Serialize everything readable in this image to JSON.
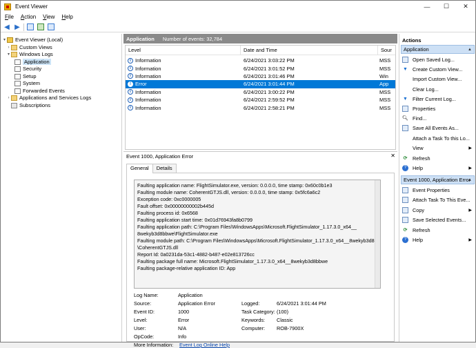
{
  "window": {
    "title": "Event Viewer",
    "controls": [
      "—",
      "☐",
      "✕"
    ]
  },
  "menu": [
    {
      "accel": "F",
      "rest": "ile"
    },
    {
      "accel": "A",
      "rest": "ction"
    },
    {
      "accel": "V",
      "rest": "iew"
    },
    {
      "accel": "H",
      "rest": "elp"
    }
  ],
  "tree": [
    {
      "label": "Event Viewer (Local)",
      "level": 0,
      "arrow": "▾",
      "icon": "event-viewer-icon"
    },
    {
      "label": "Custom Views",
      "level": 1,
      "arrow": "›",
      "icon": "folder-icon"
    },
    {
      "label": "Windows Logs",
      "level": 1,
      "arrow": "▾",
      "icon": "folder-icon"
    },
    {
      "label": "Application",
      "level": 2,
      "arrow": "",
      "icon": "log-icon",
      "selected": true
    },
    {
      "label": "Security",
      "level": 2,
      "arrow": "",
      "icon": "log-icon"
    },
    {
      "label": "Setup",
      "level": 2,
      "arrow": "",
      "icon": "log-icon"
    },
    {
      "label": "System",
      "level": 2,
      "arrow": "",
      "icon": "log-icon"
    },
    {
      "label": "Forwarded Events",
      "level": 2,
      "arrow": "",
      "icon": "log-icon"
    },
    {
      "label": "Applications and Services Logs",
      "level": 1,
      "arrow": "›",
      "icon": "folder-icon"
    },
    {
      "label": "Subscriptions",
      "level": 1,
      "arrow": "",
      "icon": "subscriptions-icon"
    }
  ],
  "list": {
    "title": "Application",
    "count": "Number of events: 32,784",
    "columns": [
      "Level",
      "Date and Time",
      "Sour"
    ],
    "rows": [
      {
        "level": "Information",
        "date": "6/24/2021 3:03:22 PM",
        "source": "MSS"
      },
      {
        "level": "Information",
        "date": "6/24/2021 3:01:52 PM",
        "source": "MSS"
      },
      {
        "level": "Information",
        "date": "6/24/2021 3:01:46 PM",
        "source": "Win"
      },
      {
        "level": "Error",
        "date": "6/24/2021 3:01:44 PM",
        "source": "App",
        "selected": true
      },
      {
        "level": "Information",
        "date": "6/24/2021 3:00:22 PM",
        "source": "MSS"
      },
      {
        "level": "Information",
        "date": "6/24/2021 2:59:52 PM",
        "source": "MSS"
      },
      {
        "level": "Information",
        "date": "6/24/2021 2:58:21 PM",
        "source": "MSS"
      }
    ]
  },
  "detail": {
    "title": "Event 1000, Application Error",
    "close": "✕",
    "tabs": [
      "General",
      "Details"
    ],
    "message": [
      "Faulting application name: FlightSimulator.exe, version: 0.0.0.0, time stamp: 0x60c0b1e3",
      "Faulting module name: CoherentGTJS.dll, version: 0.0.0.0, time stamp: 0x5fc6a6c2",
      "Exception code: 0xc0000005",
      "Fault offset: 0x00000000002b445d",
      "Faulting process id: 0x6568",
      "Faulting application start time: 0x01d76943fa8b0799",
      "Faulting application path: C:\\Program Files\\WindowsApps\\Microsoft.FlightSimulator_1.17.3.0_x64__",
      "8wekyb3d8bbwe\\FlightSimulator.exe",
      "Faulting module path: C:\\Program Files\\WindowsApps\\Microsoft.FlightSimulator_1.17.3.0_x64__8wekyb3d8bbwe",
      "\\CoherentGTJS.dll",
      "Report Id: 0a0231da-53c1-4882-b487-e02e813726cc",
      "Faulting package full name: Microsoft.FlightSimulator_1.17.3.0_x64__8wekyb3d8bbwe",
      "Faulting package-relative application ID: App"
    ],
    "props": {
      "log_name_label": "Log Name:",
      "log_name": "Application",
      "source_label": "Source:",
      "source": "Application Error",
      "logged_label": "Logged:",
      "logged": "6/24/2021 3:01:44 PM",
      "event_id_label": "Event ID:",
      "event_id": "1000",
      "task_label": "Task Category:",
      "task": "(100)",
      "level_label": "Level:",
      "level": "Error",
      "keywords_label": "Keywords:",
      "keywords": "Classic",
      "user_label": "User:",
      "user": "N/A",
      "computer_label": "Computer:",
      "computer": "ROB-7900X",
      "opcode_label": "OpCode:",
      "opcode": "Info",
      "more_label": "More Information:",
      "more_link": "Event Log Online Help"
    }
  },
  "actions": {
    "header": "Actions",
    "section1": "Application",
    "items1": [
      {
        "label": "Open Saved Log...",
        "icon": "open-log-icon"
      },
      {
        "label": "Create Custom View...",
        "icon": "filter-icon"
      },
      {
        "label": "Import Custom View...",
        "icon": ""
      },
      {
        "label": "Clear Log...",
        "icon": ""
      },
      {
        "label": "Filter Current Log...",
        "icon": "filter-icon"
      },
      {
        "label": "Properties",
        "icon": "properties-icon"
      },
      {
        "label": "Find...",
        "icon": "find-icon"
      },
      {
        "label": "Save All Events As...",
        "icon": "save-icon"
      },
      {
        "label": "Attach a Task To this Lo...",
        "icon": ""
      },
      {
        "label": "View",
        "icon": "",
        "submenu": true
      },
      {
        "label": "Refresh",
        "icon": "refresh-icon"
      },
      {
        "label": "Help",
        "icon": "help-icon",
        "submenu": true
      }
    ],
    "section2": "Event 1000, Application Error",
    "items2": [
      {
        "label": "Event Properties",
        "icon": "properties-icon"
      },
      {
        "label": "Attach Task To This Eve...",
        "icon": "task-icon"
      },
      {
        "label": "Copy",
        "icon": "copy-icon",
        "submenu": true
      },
      {
        "label": "Save Selected Events...",
        "icon": "save-icon"
      },
      {
        "label": "Refresh",
        "icon": "refresh-icon"
      },
      {
        "label": "Help",
        "icon": "help-icon",
        "submenu": true
      }
    ]
  }
}
